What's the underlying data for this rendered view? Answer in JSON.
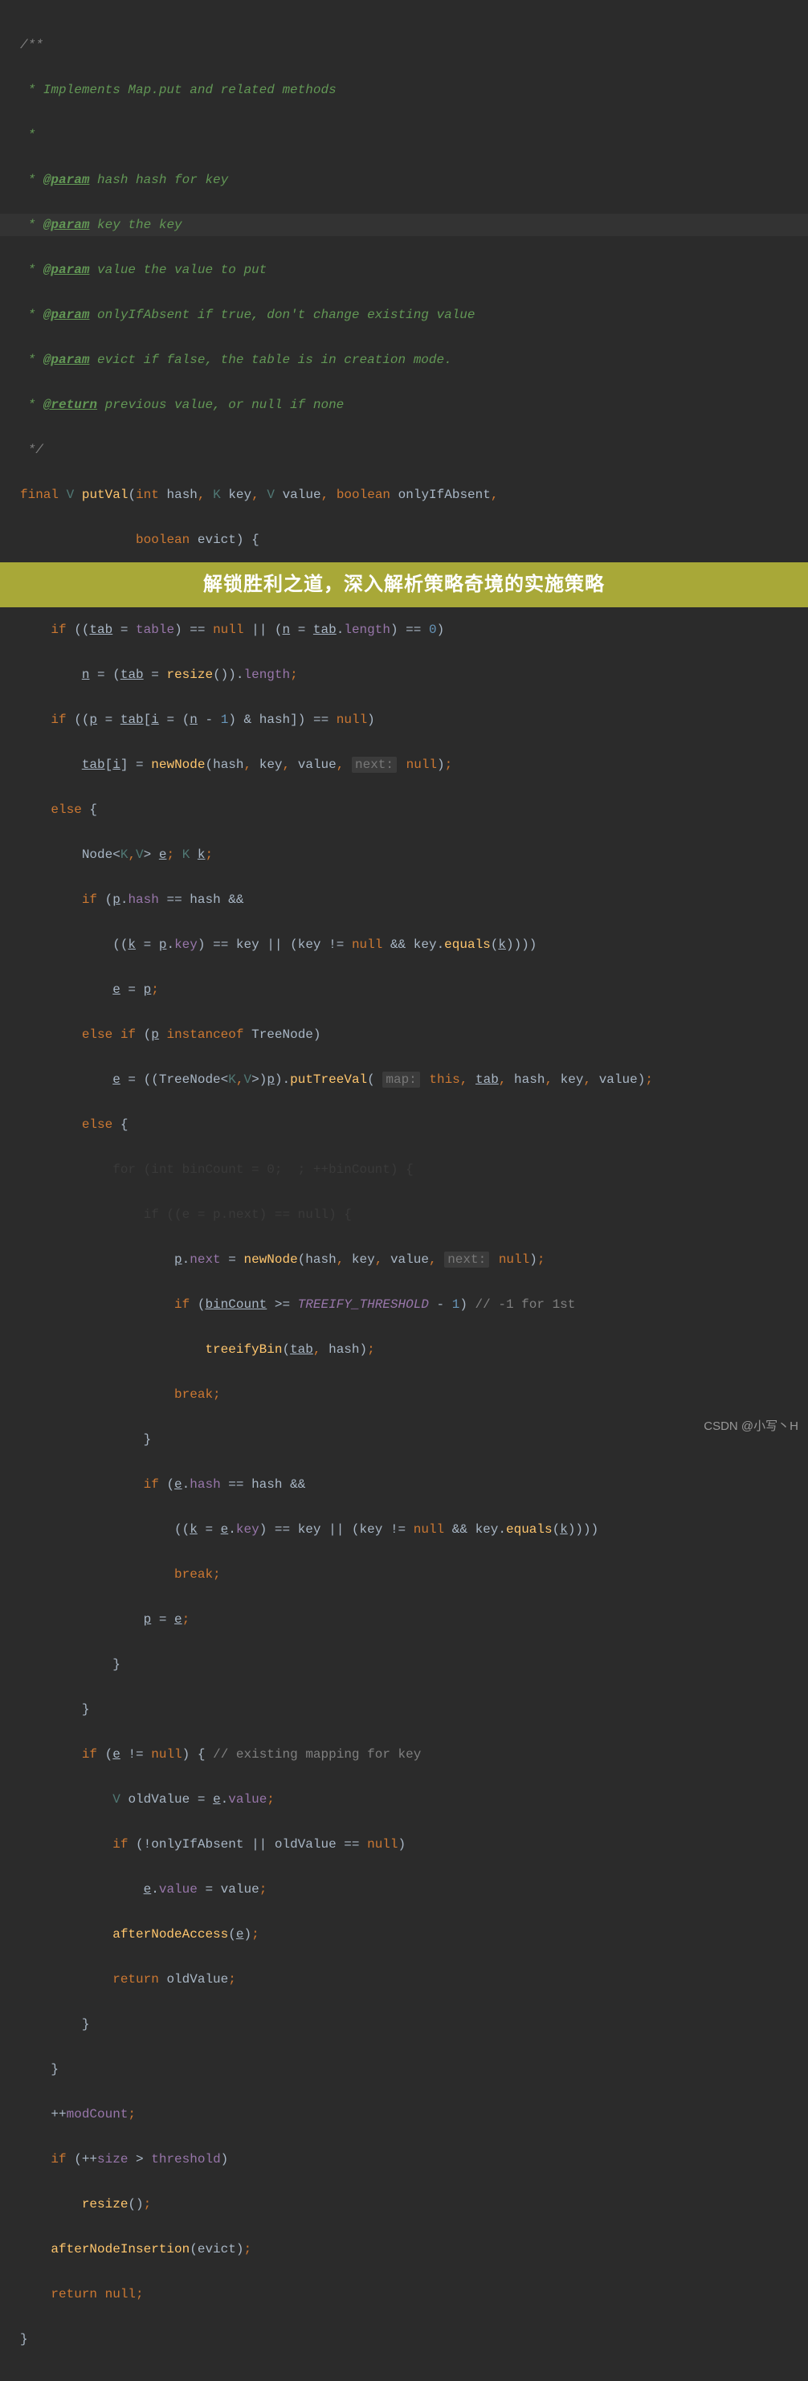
{
  "doc": {
    "open": "/**",
    "line1": " * Implements Map.put and related methods",
    "blank": " *",
    "p_hash_tag": "@param",
    "p_hash": " hash hash for key",
    "p_key_tag": "@param",
    "p_key": " key the key",
    "p_value_tag": "@param",
    "p_value": " value the value to put",
    "p_only_tag": "@param",
    "p_only": " onlyIfAbsent if true, don't change existing value",
    "p_evict_tag": "@param",
    "p_evict": " evict if false, the table is in creation mode.",
    "p_return_tag": "@return",
    "p_return": " previous value, or null if none",
    "close": " */",
    "star": " * "
  },
  "kw": {
    "final": "final",
    "int": "int",
    "boolean": "boolean",
    "if": "if",
    "else": "else",
    "null": "null",
    "instanceof": "instanceof",
    "break": "break",
    "return": "return",
    "this": "this",
    "for": "for"
  },
  "tv": {
    "V": "V",
    "K": "K"
  },
  "id": {
    "putVal": "putVal",
    "hash": "hash",
    "key": "key",
    "value": "value",
    "onlyIfAbsent": "onlyIfAbsent",
    "evict": "evict",
    "Node": "Node",
    "tab": "tab",
    "p": "p",
    "n": "n",
    "i": "i",
    "table": "table",
    "length": "length",
    "resize": "resize",
    "newNode": "newNode",
    "e": "e",
    "k": "k",
    "equals": "equals",
    "TreeNode": "TreeNode",
    "putTreeVal": "putTreeVal",
    "binCount": "binCount",
    "next": "next",
    "TREEIFY_THRESHOLD": "TREEIFY_THRESHOLD",
    "treeifyBin": "treeifyBin",
    "oldValue": "oldValue",
    "afterNodeAccess": "afterNodeAccess",
    "modCount": "modCount",
    "size": "size",
    "threshold": "threshold",
    "afterNodeInsertion": "afterNodeInsertion"
  },
  "hints": {
    "next": "next:",
    "map": "map:"
  },
  "num": {
    "zero": "0",
    "one": "1"
  },
  "comments": {
    "existing": "// existing mapping for key",
    "minus1": "// -1 for 1st",
    "for_ob": "for (int binCount = 0;  ; ++binCount) {",
    "if_ob": "if ((e = p.next) == null) {"
  },
  "banner": "解锁胜利之道，深入解析策略奇境的实施策略",
  "watermark": "CSDN @小写丶H"
}
